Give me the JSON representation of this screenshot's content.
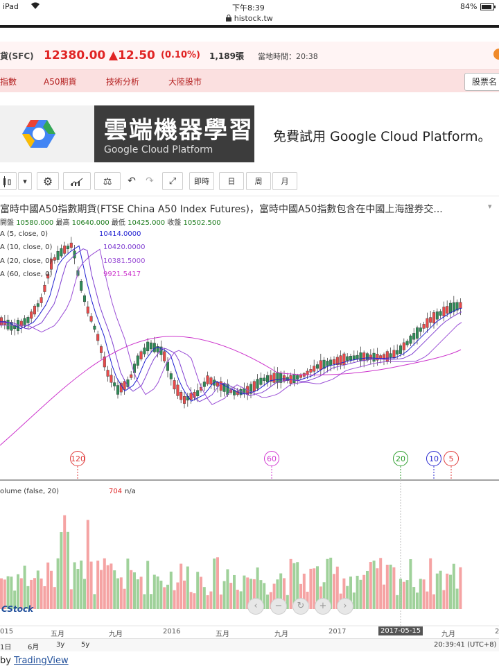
{
  "statusbar": {
    "device": "iPad",
    "time": "下午8:39",
    "battery": "84%"
  },
  "browser": {
    "url": "histock.tw"
  },
  "quote": {
    "symbol": "貨(SFC)",
    "price": "12380.00",
    "change": "▲12.50",
    "percent": "(0.10%)",
    "volume": "1,189張",
    "local_time_label": "當地時間：20:38"
  },
  "nav": {
    "items": [
      "指數",
      "A50期貨",
      "技術分析",
      "大陸股市"
    ],
    "search_placeholder": "股票名"
  },
  "ad": {
    "title": "雲端機器學習",
    "subtitle": "Google Cloud Platform",
    "cta": "免費試用 Google Cloud Platform。"
  },
  "toolbar": {
    "interval_buttons": [
      "即時",
      "日",
      "周",
      "月"
    ]
  },
  "chart": {
    "title": "富時中國A50指數期貨(FTSE China A50 Index Futures)，富時中國A50指數包含在中國上海證券交...",
    "ohlc": {
      "open_label": "開盤",
      "open": "10580.000",
      "high_label": "最高",
      "high": "10640.000",
      "low_label": "最低",
      "low": "10425.000",
      "close_label": "收盤",
      "close": "10502.500"
    },
    "indicators": [
      {
        "label": "A (5, close, 0)",
        "value": "10414.0000",
        "color": "#1f1fd1"
      },
      {
        "label": "A (10, close, 0)",
        "value": "10420.0000",
        "color": "#7f3fd1"
      },
      {
        "label": "A (20, close, 0)",
        "value": "10381.5000",
        "color": "#9b4fd6"
      },
      {
        "label": "A (60, close, 0)",
        "value": "9921.5417",
        "color": "#cc33cc"
      }
    ],
    "markers": [
      {
        "label": "120",
        "color": "#e03a3a"
      },
      {
        "label": "60",
        "color": "#d23ad2"
      },
      {
        "label": "20",
        "color": "#2a9d2a"
      },
      {
        "label": "10",
        "color": "#2a2ad0"
      },
      {
        "label": "5",
        "color": "#e03a3a"
      }
    ],
    "volume": {
      "label": "olume (false, 20)",
      "value": "704",
      "na": "n/a"
    },
    "xaxis": [
      "015",
      "五月",
      "九月",
      "2016",
      "五月",
      "九月",
      "2017",
      "2017-05-15",
      "九月",
      "2"
    ],
    "ranges": [
      "1日",
      "6月",
      "3y",
      "5y"
    ],
    "time_readout": "20:39:41 (UTC+8)",
    "logo": "CStock"
  },
  "footer": {
    "prefix": "by",
    "link": "TradingView"
  },
  "colors": {
    "up": "#e84a4a",
    "down": "#2e8b57",
    "vol_up": "#f5a3a3",
    "vol_down": "#9fd19a",
    "accent": "#b42020"
  }
}
